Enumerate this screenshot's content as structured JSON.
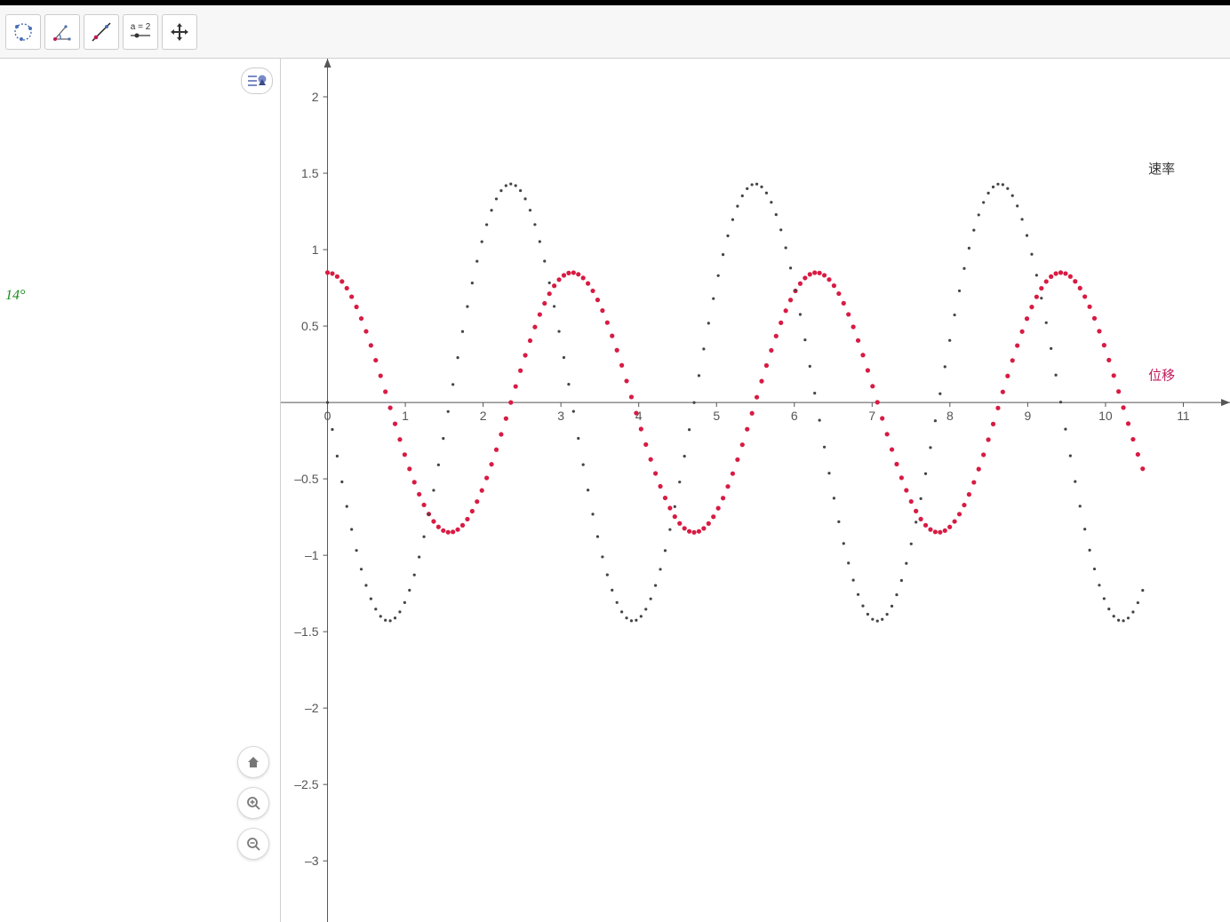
{
  "toolbar": {
    "tools": [
      {
        "name": "point-tool"
      },
      {
        "name": "angle-tool"
      },
      {
        "name": "tangent-tool"
      },
      {
        "name": "slider-tool",
        "label": "a = 2"
      },
      {
        "name": "move-graphics-tool"
      }
    ]
  },
  "algebra": {
    "angle_value": "14°",
    "toggle_name": "algebra-style-toggle"
  },
  "controls": {
    "home": "home",
    "zoom_in": "zoom-in",
    "zoom_out": "zoom-out"
  },
  "chart_data": {
    "type": "scatter",
    "xlabel": "",
    "ylabel": "",
    "xlim": [
      -0.6,
      11.6
    ],
    "ylim": [
      -3.4,
      2.25
    ],
    "xticks": [
      0,
      1,
      2,
      3,
      4,
      5,
      6,
      7,
      8,
      9,
      10,
      11
    ],
    "yticks": [
      2,
      1.5,
      1,
      0.5,
      -0.5,
      -1,
      -1.5,
      -2,
      -2.5,
      -3
    ],
    "series": [
      {
        "name": "位移",
        "color": "#d81b43",
        "label_pos": {
          "x": 10.55,
          "y": 0.15
        },
        "function": "0.85*cos(2*x)",
        "amp": 0.85,
        "omega": 2,
        "phase": 0,
        "x_start": 0,
        "x_end": 10.48,
        "step": 0.062
      },
      {
        "name": "速率",
        "color": "#444",
        "label_pos": {
          "x": 10.55,
          "y": 1.5
        },
        "function": "-1.43*sin(2*x)",
        "amp": -1.43,
        "omega": 2,
        "phase": 0,
        "x_start": 0,
        "x_end": 10.48,
        "step": 0.062
      }
    ]
  }
}
